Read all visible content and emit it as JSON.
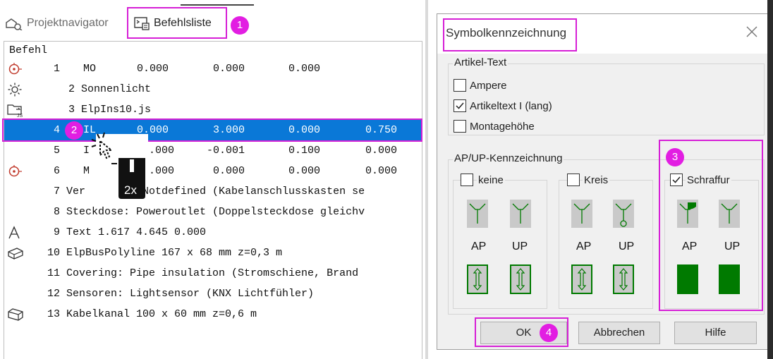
{
  "tabs": {
    "projektnavigator": "Projektnavigator",
    "befehlsliste": "Befehlsliste"
  },
  "list": {
    "header": "Befehl",
    "rows": [
      {
        "icon": "target-icon",
        "num": "1",
        "cmd": "MO",
        "v1": "0.000",
        "v2": "0.000",
        "v3": "0.000",
        "v4": ""
      },
      {
        "icon": "sun-icon",
        "text": "2 Sonnenlicht"
      },
      {
        "icon": "js-folder-icon",
        "text": "3 ElpIns10.js"
      },
      {
        "icon": "",
        "num": "4",
        "cmd": "IL",
        "v1": "0.000",
        "v2": "3.000",
        "v3": "0.000",
        "v4": "0.750"
      },
      {
        "icon": "",
        "num": "5",
        "cmd": "I",
        "v1": ".000",
        "v2": "-0.001",
        "v3": "0.100",
        "v4": "0.000"
      },
      {
        "icon": "target-icon",
        "num": "6",
        "cmd": "M",
        "v1": ".000",
        "v2": "0.000",
        "v3": "0.000",
        "v4": "0.000"
      },
      {
        "icon": "",
        "text": "7 Ver         Notdefined (Kabelanschlusskasten se"
      },
      {
        "icon": "",
        "text": "8 Steckdose: Poweroutlet (Doppelsteckdose gleichv"
      },
      {
        "icon": "text-a-icon",
        "text": "9 Text 1.617 4.645 0.000"
      },
      {
        "icon": "bus-polyline-icon",
        "text": "10 ElpBusPolyline 167 x 68 mm z=0,3 m"
      },
      {
        "icon": "",
        "text": "11 Covering: Pipe insulation (Stromschiene, Brand"
      },
      {
        "icon": "",
        "text": "12 Sensoren: Lightsensor (KNX Lichtfühler)"
      },
      {
        "icon": "cable-duct-icon",
        "text": "13 Kabelkanal 100 x 60 mm z=0,6 m"
      }
    ]
  },
  "annotations": {
    "badge1": "1",
    "badge2": "2",
    "badge3": "3",
    "badge4": "4",
    "dblclick": "2x"
  },
  "dialog": {
    "title": "Symbolkennzeichnung",
    "artikel_group": "Artikel-Text",
    "artikel_options": [
      {
        "label": "Ampere",
        "checked": false
      },
      {
        "label": "Artikeltext I (lang)",
        "checked": true
      },
      {
        "label": "Montagehöhe",
        "checked": false
      }
    ],
    "apup_group": "AP/UP-Kennzeichnung",
    "apup_options": [
      {
        "label": "keine",
        "checked": false
      },
      {
        "label": "Kreis",
        "checked": false
      },
      {
        "label": "Schraffur",
        "checked": true
      }
    ],
    "ap_label": "AP",
    "up_label": "UP",
    "buttons": {
      "ok": "OK",
      "abbrechen": "Abbrechen",
      "hilfe": "Hilfe"
    }
  },
  "colors": {
    "highlight": "#d61fd6",
    "badge": "#e21ee2",
    "selection": "#0a78d7",
    "symbol_green": "#008000"
  }
}
